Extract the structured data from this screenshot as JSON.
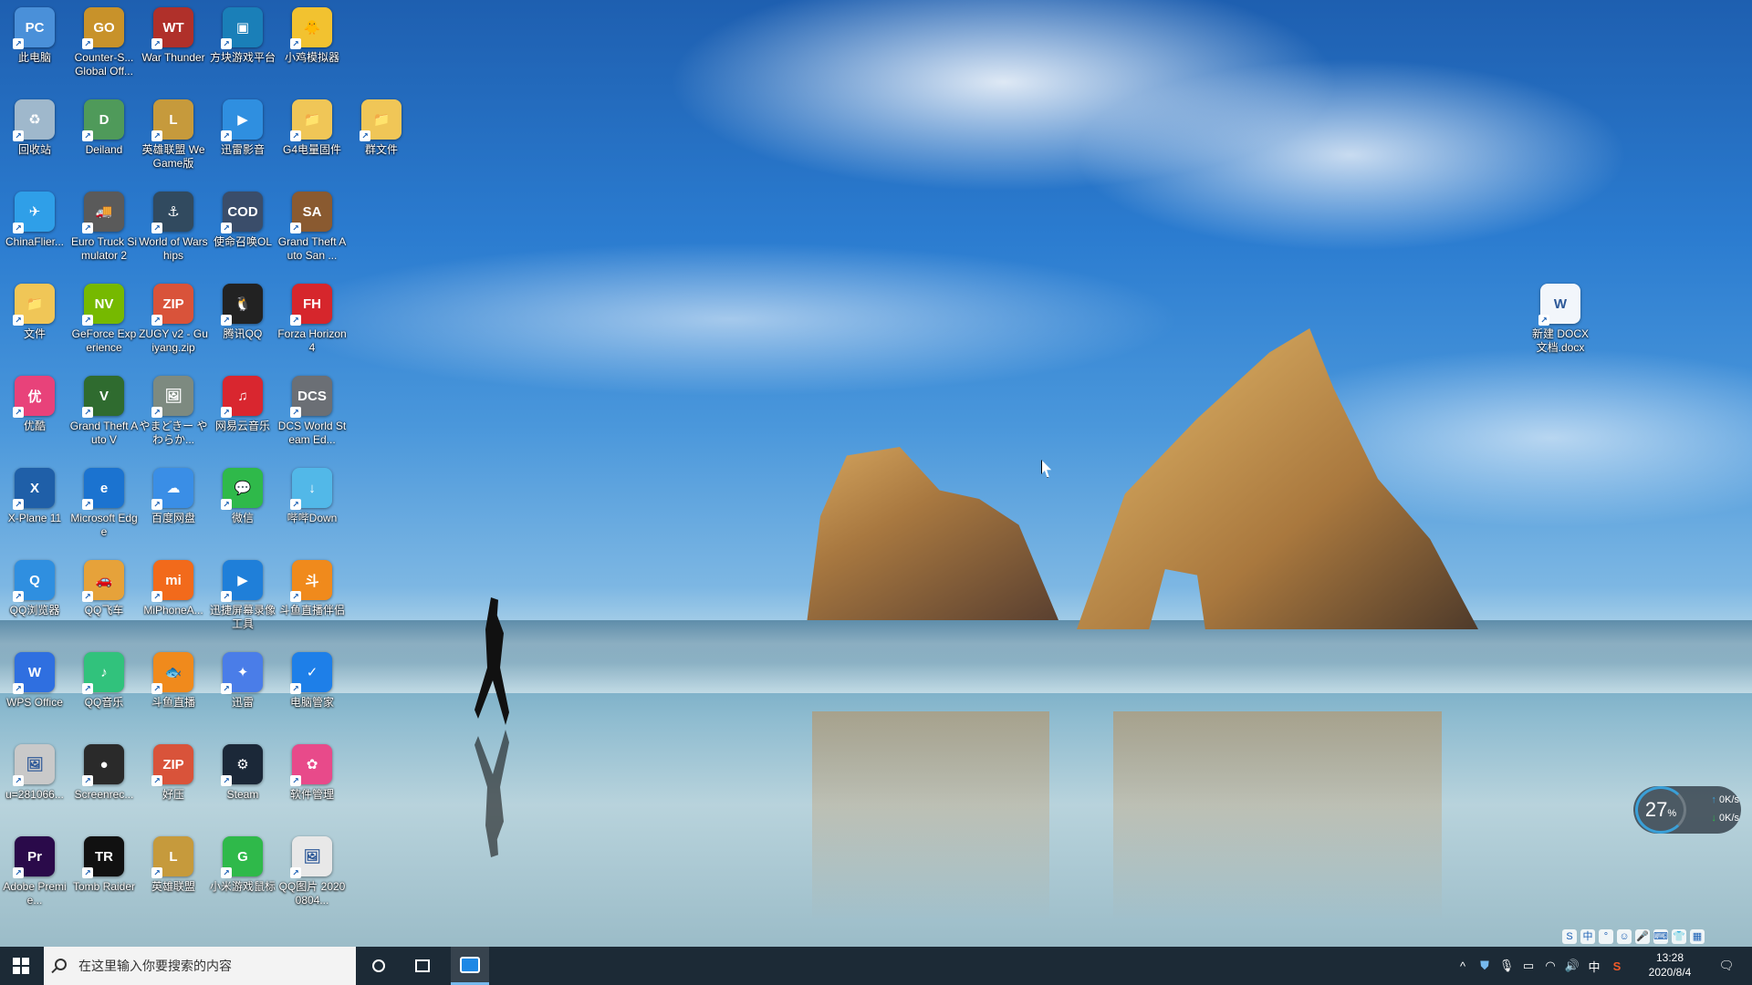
{
  "desktop": {
    "icons": [
      {
        "label": "此电脑",
        "icon": "computer-icon",
        "color": "#4a90d9"
      },
      {
        "label": "Counter-S... Global Off...",
        "icon": "csgo-icon",
        "color": "#c8922a"
      },
      {
        "label": "War Thunder",
        "icon": "war-thunder-icon",
        "color": "#b0302a"
      },
      {
        "label": "方块游戏平台",
        "icon": "cube-platform-icon",
        "color": "#1a7fb8"
      },
      {
        "label": "小鸡模拟器",
        "icon": "chick-emulator-icon",
        "color": "#f2c230"
      },
      {
        "label": "回收站",
        "icon": "recycle-bin-icon",
        "color": "#9fb8cc"
      },
      {
        "label": "Deiland",
        "icon": "deiland-icon",
        "color": "#4f9a5a"
      },
      {
        "label": "英雄联盟 WeGame版",
        "icon": "league-wegame-icon",
        "color": "#c69a3c"
      },
      {
        "label": "迅雷影音",
        "icon": "xunlei-player-icon",
        "color": "#2f8fe0"
      },
      {
        "label": "G4电量固件",
        "icon": "folder-icon",
        "color": "#f0c657"
      },
      {
        "label": "群文件",
        "icon": "folder-icon",
        "color": "#f0c657"
      },
      {
        "label": "ChinaFlier...",
        "icon": "chinaflier-icon",
        "color": "#2f9fe8"
      },
      {
        "label": "Euro Truck Simulator 2",
        "icon": "euro-truck-icon",
        "color": "#5a5a5a"
      },
      {
        "label": "World of Warships",
        "icon": "world-of-warships-icon",
        "color": "#314a5f"
      },
      {
        "label": "使命召唤OL",
        "icon": "call-of-duty-icon",
        "color": "#3a4d6a"
      },
      {
        "label": "Grand Theft Auto San ...",
        "icon": "gta-san-andreas-icon",
        "color": "#8a5a30"
      },
      {
        "label": "文件",
        "icon": "folder-icon",
        "color": "#f0c657"
      },
      {
        "label": "GeForce Experience",
        "icon": "nvidia-icon",
        "color": "#76b900"
      },
      {
        "label": "ZUGY v2 - Guiyang.zip",
        "icon": "zip-archive-icon",
        "color": "#d9533a"
      },
      {
        "label": "腾讯QQ",
        "icon": "qq-penguin-icon",
        "color": "#222222"
      },
      {
        "label": "Forza Horizon 4",
        "icon": "forza-icon",
        "color": "#d6262c"
      },
      {
        "label": "优酷",
        "icon": "youku-icon",
        "color": "#e8427a"
      },
      {
        "label": "Grand Theft Auto V",
        "icon": "gta-v-icon",
        "color": "#2f6b2f"
      },
      {
        "label": "やまどきー やわらか...",
        "icon": "image-file-icon",
        "color": "#7d8a80"
      },
      {
        "label": "网易云音乐",
        "icon": "netease-music-icon",
        "color": "#d9262f"
      },
      {
        "label": "DCS World Steam Ed...",
        "icon": "dcs-world-icon",
        "color": "#6b6f75"
      },
      {
        "label": "X-Plane 11",
        "icon": "x-plane-icon",
        "color": "#1f5fa8"
      },
      {
        "label": "Microsoft Edge",
        "icon": "edge-icon",
        "color": "#1b73d0"
      },
      {
        "label": "百度网盘",
        "icon": "baidu-netdisk-icon",
        "color": "#3a8ee6"
      },
      {
        "label": "微信",
        "icon": "wechat-icon",
        "color": "#2fb94a"
      },
      {
        "label": "哔哔Down",
        "icon": "bilibili-down-icon",
        "color": "#52b8e8"
      },
      {
        "label": "QQ浏览器",
        "icon": "qq-browser-icon",
        "color": "#2f8fe0"
      },
      {
        "label": "QQ飞车",
        "icon": "qq-speed-icon",
        "color": "#e6a23a"
      },
      {
        "label": "MiPhoneA...",
        "icon": "mi-phone-icon",
        "color": "#f26a1b"
      },
      {
        "label": "迅捷屏幕录像工具",
        "icon": "screen-recorder-icon",
        "color": "#1f7fd9"
      },
      {
        "label": "斗鱼直播伴侣",
        "icon": "douyu-companion-icon",
        "color": "#f08a1c"
      },
      {
        "label": "WPS Office",
        "icon": "wps-icon",
        "color": "#2f6fe0"
      },
      {
        "label": "QQ音乐",
        "icon": "qq-music-icon",
        "color": "#31c27c"
      },
      {
        "label": "斗鱼直播",
        "icon": "douyu-icon",
        "color": "#f08a1c"
      },
      {
        "label": "迅雷",
        "icon": "xunlei-icon",
        "color": "#4a7de8"
      },
      {
        "label": "电脑管家",
        "icon": "pc-manager-icon",
        "color": "#1e7fe8"
      },
      {
        "label": "u=281066...",
        "icon": "image-file-icon",
        "color": "#c9c9c9"
      },
      {
        "label": "Screenrec...",
        "icon": "screenrec-icon",
        "color": "#2a2a2a"
      },
      {
        "label": "好压",
        "icon": "haozip-icon",
        "color": "#d9533a"
      },
      {
        "label": "Steam",
        "icon": "steam-icon",
        "color": "#1b2838"
      },
      {
        "label": "软件管理",
        "icon": "software-manager-icon",
        "color": "#e84a8a"
      },
      {
        "label": "Adobe Premie...",
        "icon": "premiere-icon",
        "color": "#2a0a4a"
      },
      {
        "label": "Tomb Raider",
        "icon": "tomb-raider-icon",
        "color": "#111111"
      },
      {
        "label": "英雄联盟",
        "icon": "league-icon",
        "color": "#c69a3c"
      },
      {
        "label": "小米游戏鼠标",
        "icon": "mi-gaming-mouse-icon",
        "color": "#2fb94a"
      },
      {
        "label": "QQ图片 20200804...",
        "icon": "image-file-icon",
        "color": "#e8e8e8"
      },
      {
        "label": "新建 DOCX 文档.docx",
        "icon": "word-document-icon",
        "color": "#f2f6fb"
      }
    ],
    "icon_glyphs": [
      "PC",
      "GO",
      "WT",
      "▣",
      "🐥",
      "♻",
      "D",
      "L",
      "▶",
      "📁",
      "📁",
      "✈",
      "🚚",
      "⚓",
      "COD",
      "SA",
      "📁",
      "NV",
      "ZIP",
      "🐧",
      "FH",
      "优",
      "V",
      "🖼",
      "♫",
      "DCS",
      "X",
      "e",
      "☁",
      "💬",
      "↓",
      "Q",
      "🚗",
      "mi",
      "▶",
      "斗",
      "W",
      "♪",
      "🐟",
      "✦",
      "✓",
      "🖼",
      "●",
      "ZIP",
      "⚙",
      "✿",
      "Pr",
      "TR",
      "L",
      "G",
      "🖼",
      "W"
    ]
  },
  "taskbar": {
    "search_placeholder": "在这里输入你要搜索的内容",
    "time": "13:28",
    "date": "2020/8/4",
    "ime_label": "中",
    "ime_bar": [
      "S",
      "中",
      "°",
      "☺",
      "🎤",
      "⌨",
      "👕",
      "▦"
    ]
  },
  "net_monitor": {
    "percent": "27",
    "unit": "%",
    "up": "0K/s",
    "down": "0K/s"
  },
  "colors": {
    "taskbar_bg": "#1c2a36",
    "accent": "#76b9ed"
  }
}
